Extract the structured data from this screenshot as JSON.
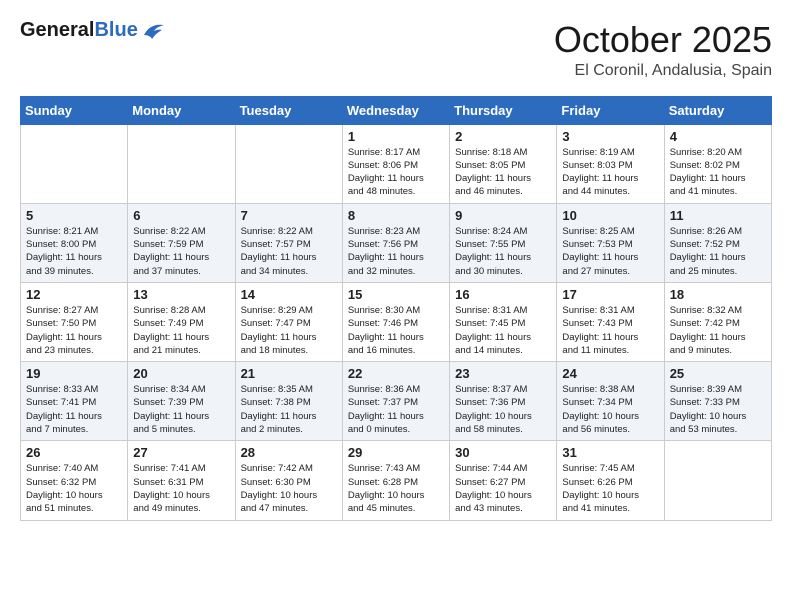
{
  "header": {
    "logo_general": "General",
    "logo_blue": "Blue",
    "month_title": "October 2025",
    "location": "El Coronil, Andalusia, Spain"
  },
  "weekdays": [
    "Sunday",
    "Monday",
    "Tuesday",
    "Wednesday",
    "Thursday",
    "Friday",
    "Saturday"
  ],
  "weeks": [
    [
      {
        "day": "",
        "info": ""
      },
      {
        "day": "",
        "info": ""
      },
      {
        "day": "",
        "info": ""
      },
      {
        "day": "1",
        "info": "Sunrise: 8:17 AM\nSunset: 8:06 PM\nDaylight: 11 hours\nand 48 minutes."
      },
      {
        "day": "2",
        "info": "Sunrise: 8:18 AM\nSunset: 8:05 PM\nDaylight: 11 hours\nand 46 minutes."
      },
      {
        "day": "3",
        "info": "Sunrise: 8:19 AM\nSunset: 8:03 PM\nDaylight: 11 hours\nand 44 minutes."
      },
      {
        "day": "4",
        "info": "Sunrise: 8:20 AM\nSunset: 8:02 PM\nDaylight: 11 hours\nand 41 minutes."
      }
    ],
    [
      {
        "day": "5",
        "info": "Sunrise: 8:21 AM\nSunset: 8:00 PM\nDaylight: 11 hours\nand 39 minutes."
      },
      {
        "day": "6",
        "info": "Sunrise: 8:22 AM\nSunset: 7:59 PM\nDaylight: 11 hours\nand 37 minutes."
      },
      {
        "day": "7",
        "info": "Sunrise: 8:22 AM\nSunset: 7:57 PM\nDaylight: 11 hours\nand 34 minutes."
      },
      {
        "day": "8",
        "info": "Sunrise: 8:23 AM\nSunset: 7:56 PM\nDaylight: 11 hours\nand 32 minutes."
      },
      {
        "day": "9",
        "info": "Sunrise: 8:24 AM\nSunset: 7:55 PM\nDaylight: 11 hours\nand 30 minutes."
      },
      {
        "day": "10",
        "info": "Sunrise: 8:25 AM\nSunset: 7:53 PM\nDaylight: 11 hours\nand 27 minutes."
      },
      {
        "day": "11",
        "info": "Sunrise: 8:26 AM\nSunset: 7:52 PM\nDaylight: 11 hours\nand 25 minutes."
      }
    ],
    [
      {
        "day": "12",
        "info": "Sunrise: 8:27 AM\nSunset: 7:50 PM\nDaylight: 11 hours\nand 23 minutes."
      },
      {
        "day": "13",
        "info": "Sunrise: 8:28 AM\nSunset: 7:49 PM\nDaylight: 11 hours\nand 21 minutes."
      },
      {
        "day": "14",
        "info": "Sunrise: 8:29 AM\nSunset: 7:47 PM\nDaylight: 11 hours\nand 18 minutes."
      },
      {
        "day": "15",
        "info": "Sunrise: 8:30 AM\nSunset: 7:46 PM\nDaylight: 11 hours\nand 16 minutes."
      },
      {
        "day": "16",
        "info": "Sunrise: 8:31 AM\nSunset: 7:45 PM\nDaylight: 11 hours\nand 14 minutes."
      },
      {
        "day": "17",
        "info": "Sunrise: 8:31 AM\nSunset: 7:43 PM\nDaylight: 11 hours\nand 11 minutes."
      },
      {
        "day": "18",
        "info": "Sunrise: 8:32 AM\nSunset: 7:42 PM\nDaylight: 11 hours\nand 9 minutes."
      }
    ],
    [
      {
        "day": "19",
        "info": "Sunrise: 8:33 AM\nSunset: 7:41 PM\nDaylight: 11 hours\nand 7 minutes."
      },
      {
        "day": "20",
        "info": "Sunrise: 8:34 AM\nSunset: 7:39 PM\nDaylight: 11 hours\nand 5 minutes."
      },
      {
        "day": "21",
        "info": "Sunrise: 8:35 AM\nSunset: 7:38 PM\nDaylight: 11 hours\nand 2 minutes."
      },
      {
        "day": "22",
        "info": "Sunrise: 8:36 AM\nSunset: 7:37 PM\nDaylight: 11 hours\nand 0 minutes."
      },
      {
        "day": "23",
        "info": "Sunrise: 8:37 AM\nSunset: 7:36 PM\nDaylight: 10 hours\nand 58 minutes."
      },
      {
        "day": "24",
        "info": "Sunrise: 8:38 AM\nSunset: 7:34 PM\nDaylight: 10 hours\nand 56 minutes."
      },
      {
        "day": "25",
        "info": "Sunrise: 8:39 AM\nSunset: 7:33 PM\nDaylight: 10 hours\nand 53 minutes."
      }
    ],
    [
      {
        "day": "26",
        "info": "Sunrise: 7:40 AM\nSunset: 6:32 PM\nDaylight: 10 hours\nand 51 minutes."
      },
      {
        "day": "27",
        "info": "Sunrise: 7:41 AM\nSunset: 6:31 PM\nDaylight: 10 hours\nand 49 minutes."
      },
      {
        "day": "28",
        "info": "Sunrise: 7:42 AM\nSunset: 6:30 PM\nDaylight: 10 hours\nand 47 minutes."
      },
      {
        "day": "29",
        "info": "Sunrise: 7:43 AM\nSunset: 6:28 PM\nDaylight: 10 hours\nand 45 minutes."
      },
      {
        "day": "30",
        "info": "Sunrise: 7:44 AM\nSunset: 6:27 PM\nDaylight: 10 hours\nand 43 minutes."
      },
      {
        "day": "31",
        "info": "Sunrise: 7:45 AM\nSunset: 6:26 PM\nDaylight: 10 hours\nand 41 minutes."
      },
      {
        "day": "",
        "info": ""
      }
    ]
  ]
}
